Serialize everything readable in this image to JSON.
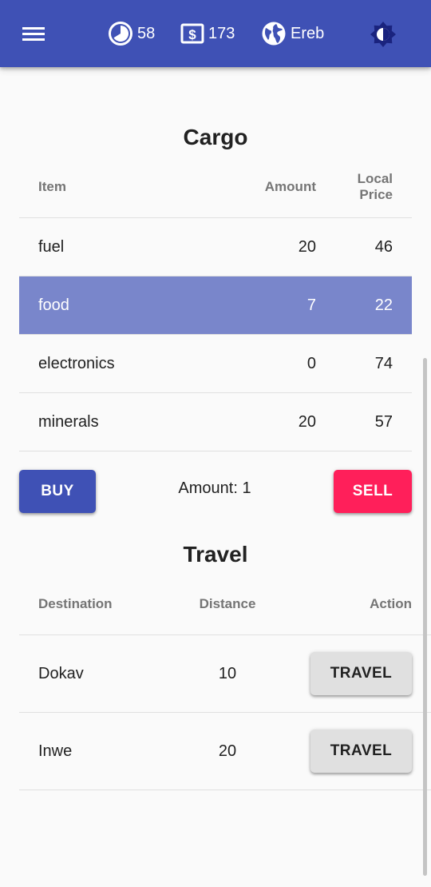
{
  "header": {
    "menu_icon": "menu-icon",
    "time": {
      "icon": "clock-icon",
      "value": "58"
    },
    "money": {
      "icon": "money-icon",
      "value": "173"
    },
    "location": {
      "icon": "globe-icon",
      "value": "Ereb"
    },
    "theme_icon": "brightness-icon"
  },
  "cargo": {
    "title": "Cargo",
    "columns": [
      "Item",
      "Amount",
      "Local Price"
    ],
    "rows": [
      {
        "item": "fuel",
        "amount": "20",
        "price": "46",
        "selected": false
      },
      {
        "item": "food",
        "amount": "7",
        "price": "22",
        "selected": true
      },
      {
        "item": "electronics",
        "amount": "0",
        "price": "74",
        "selected": false
      },
      {
        "item": "minerals",
        "amount": "20",
        "price": "57",
        "selected": false
      }
    ],
    "buy_label": "BUY",
    "amount_label": "Amount: 1",
    "sell_label": "SELL"
  },
  "travel": {
    "title": "Travel",
    "columns": [
      "Destination",
      "Distance",
      "Action"
    ],
    "rows": [
      {
        "destination": "Dokav",
        "distance": "10",
        "action_label": "TRAVEL"
      },
      {
        "destination": "Inwe",
        "distance": "20",
        "action_label": "TRAVEL"
      }
    ]
  },
  "colors": {
    "primary": "#3f51b5",
    "selected_row": "#7986cb",
    "accent": "#ff1f5a",
    "button_gray": "#e0e0e0"
  }
}
